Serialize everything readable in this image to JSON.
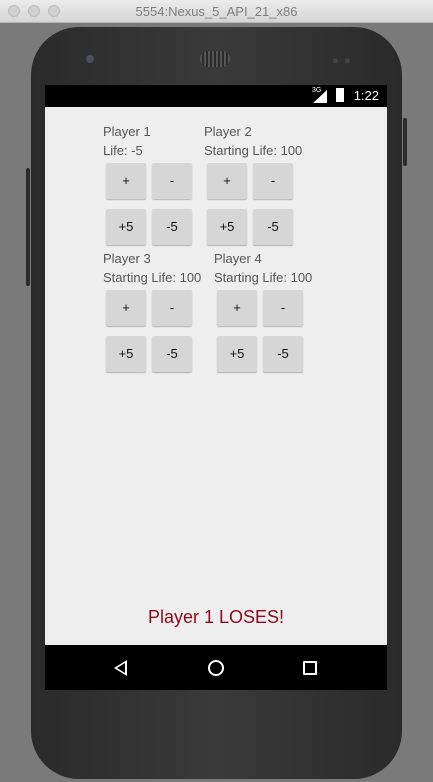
{
  "window": {
    "title": "5554:Nexus_5_API_21_x86"
  },
  "status_bar": {
    "network": "3G",
    "time": "1:22"
  },
  "players": [
    {
      "name": "Player 1",
      "life": "Life: -5",
      "buttons": {
        "plus": "+",
        "minus": "-",
        "plus5": "+5",
        "minus5": "-5"
      }
    },
    {
      "name": "Player 2",
      "life": "Starting Life: 100",
      "buttons": {
        "plus": "+",
        "minus": "-",
        "plus5": "+5",
        "minus5": "-5"
      }
    },
    {
      "name": "Player 3",
      "life": "Starting Life: 100",
      "buttons": {
        "plus": "+",
        "minus": "-",
        "plus5": "+5",
        "minus5": "-5"
      }
    },
    {
      "name": "Player 4",
      "life": "Starting Life: 100",
      "buttons": {
        "plus": "+",
        "minus": "-",
        "plus5": "+5",
        "minus5": "-5"
      }
    }
  ],
  "result": {
    "message": "Player 1 LOSES!",
    "color": "#8b0a1a"
  },
  "nav_bar": {
    "icons": [
      "back-icon",
      "home-icon",
      "recent-apps-icon"
    ]
  }
}
